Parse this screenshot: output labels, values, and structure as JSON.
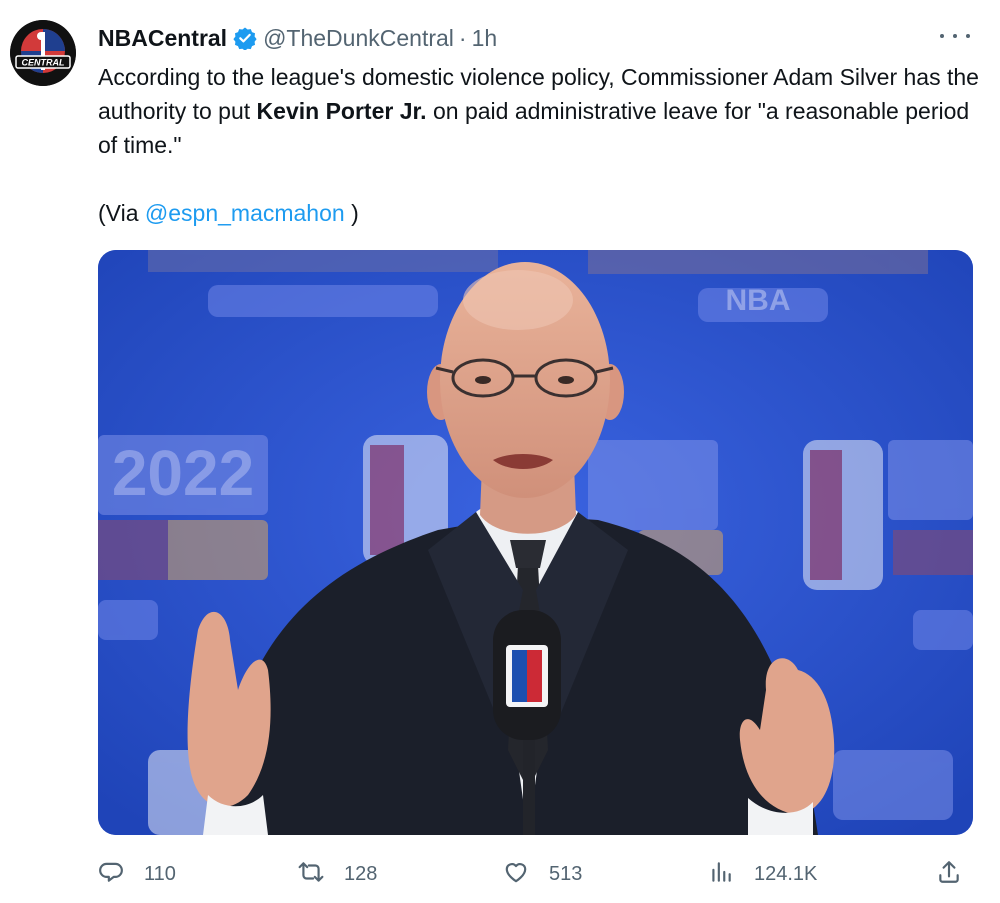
{
  "tweet": {
    "author_name": "NBACentral",
    "handle": "@TheDunkCentral",
    "separator": "·",
    "time": "1h",
    "text_before": "According to the league's domestic violence policy, Commissioner Adam Silver has the authority to put ",
    "text_bold": "Kevin Porter Jr.",
    "text_after": " on paid administrative leave for \"a reasonable period of time.\"",
    "via_prefix": "(Via ",
    "via_mention": "@espn_macmahon",
    "via_suffix": " )",
    "avatar_text": "CENTRAL",
    "media_logo_text": "NBA",
    "media_year_text": "2022"
  },
  "actions": {
    "replies": "110",
    "retweets": "128",
    "likes": "513",
    "views": "124.1K"
  },
  "icons": {
    "verified": "verified-badge-icon",
    "more": "more-horizontal-icon",
    "reply": "reply-icon",
    "retweet": "retweet-icon",
    "like": "heart-icon",
    "views": "views-icon",
    "share": "share-icon"
  },
  "colors": {
    "accent": "#1d9bf0",
    "muted": "#536471",
    "text": "#0f1419",
    "media_backdrop": "#2a4fc9"
  }
}
